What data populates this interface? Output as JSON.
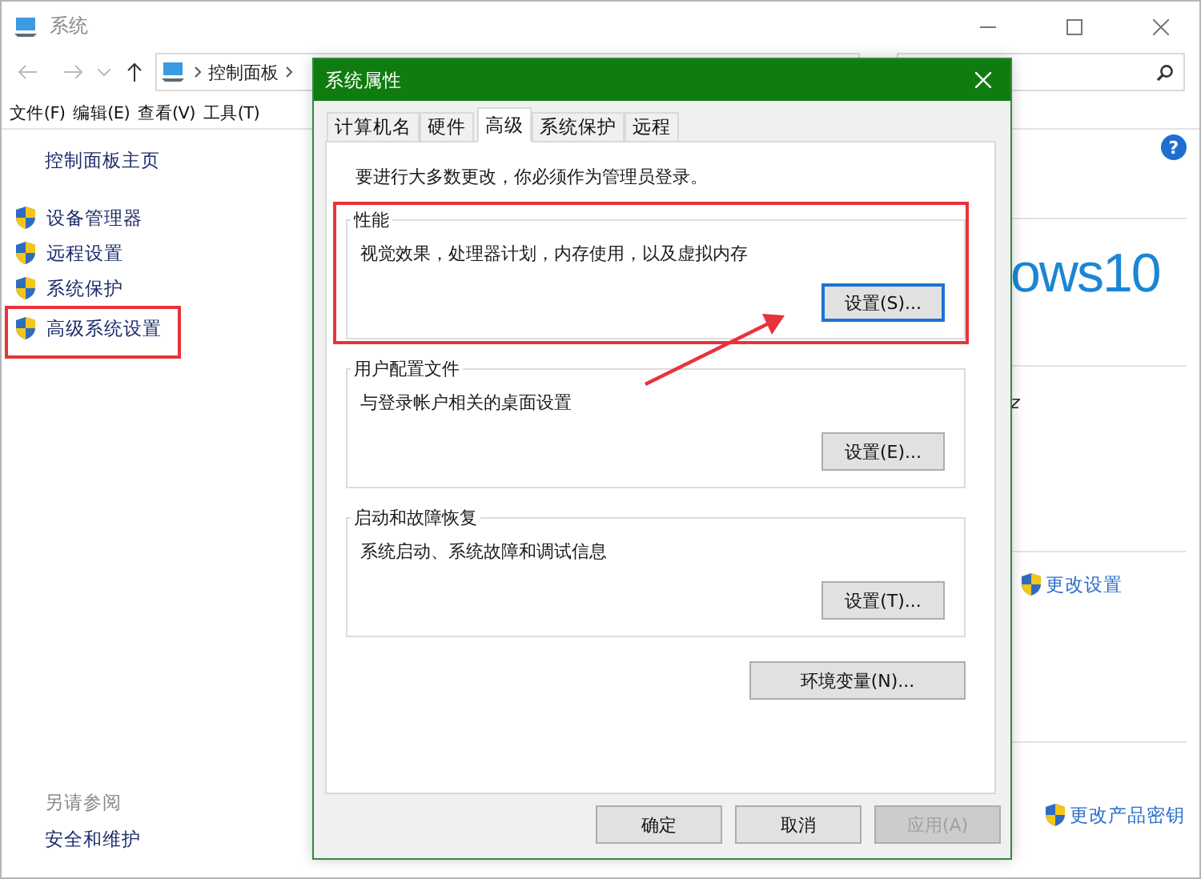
{
  "window": {
    "title": "系统"
  },
  "address": {
    "crumbs": [
      "控制面板"
    ]
  },
  "menu": [
    "文件(F)",
    "编辑(E)",
    "查看(V)",
    "工具(T)"
  ],
  "sidebar": {
    "home": "控制面板主页",
    "items": [
      {
        "label": "设备管理器",
        "highlighted": false
      },
      {
        "label": "远程设置",
        "highlighted": false
      },
      {
        "label": "系统保护",
        "highlighted": false
      },
      {
        "label": "高级系统设置",
        "highlighted": true
      }
    ],
    "see_also_title": "另请参阅",
    "see_also": [
      "安全和维护"
    ]
  },
  "main": {
    "help": "?",
    "logo_text": "ows10",
    "fragment": "z",
    "change_settings": "更改设置",
    "change_key": "更改产品密钥"
  },
  "dialog": {
    "title": "系统属性",
    "tabs": [
      {
        "label": "计算机名",
        "selected": false
      },
      {
        "label": "硬件",
        "selected": false
      },
      {
        "label": "高级",
        "selected": true
      },
      {
        "label": "系统保护",
        "selected": false
      },
      {
        "label": "远程",
        "selected": false
      }
    ],
    "notice": "要进行大多数更改，你必须作为管理员登录。",
    "groups": [
      {
        "title": "性能",
        "description": "视觉效果，处理器计划，内存使用，以及虚拟内存",
        "button": "设置(S)...",
        "focused": true,
        "highlighted": true
      },
      {
        "title": "用户配置文件",
        "description": "与登录帐户相关的桌面设置",
        "button": "设置(E)...",
        "focused": false,
        "highlighted": false
      },
      {
        "title": "启动和故障恢复",
        "description": "系统启动、系统故障和调试信息",
        "button": "设置(T)...",
        "focused": false,
        "highlighted": false
      }
    ],
    "env_button": "环境变量(N)...",
    "buttons": [
      {
        "label": "确定",
        "disabled": false
      },
      {
        "label": "取消",
        "disabled": false
      },
      {
        "label": "应用(A)",
        "disabled": true
      }
    ]
  },
  "pointer_arrow": true
}
